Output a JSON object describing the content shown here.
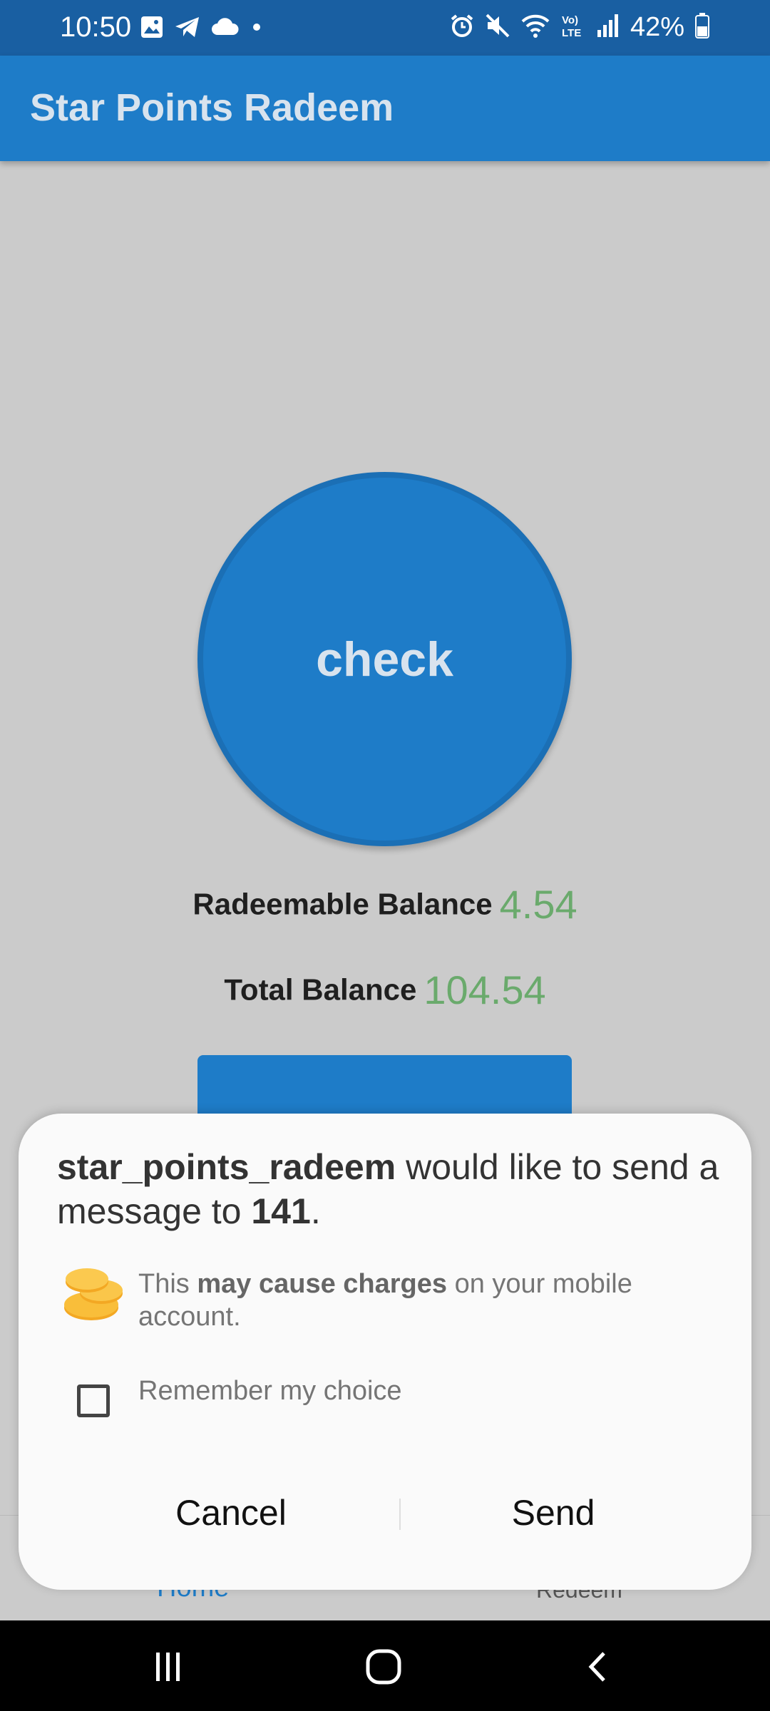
{
  "status_bar": {
    "time": "10:50",
    "battery": "42%",
    "left_icons": [
      "gallery-icon",
      "telegram-icon",
      "cloud-icon",
      "dot-icon"
    ],
    "right_icons": [
      "alarm-icon",
      "mute-icon",
      "wifi-icon",
      "volte-icon",
      "signal-icon",
      "battery-icon"
    ]
  },
  "app_bar": {
    "title": "Star Points Radeem"
  },
  "main": {
    "check_button": "check",
    "redeemable_label": "Radeemable Balance",
    "redeemable_value": "4.54",
    "total_label": "Total Balance",
    "total_value": "104.54"
  },
  "bottom_nav": {
    "home": "Home",
    "redeem": "Redeem"
  },
  "dialog": {
    "app_name": "star_points_radeem",
    "msg_middle": " would like to send a message to ",
    "recipient": "141",
    "msg_end": ".",
    "charges_prefix": "This ",
    "charges_bold": "may cause charges",
    "charges_suffix": " on your mobile account.",
    "remember_label": "Remember my choice",
    "remember_checked": false,
    "cancel": "Cancel",
    "send": "Send"
  },
  "colors": {
    "primary": "#1e7cc8",
    "status_bar": "#195fa2",
    "balance_value": "#6aaa6c",
    "background": "#cbcbcb"
  }
}
